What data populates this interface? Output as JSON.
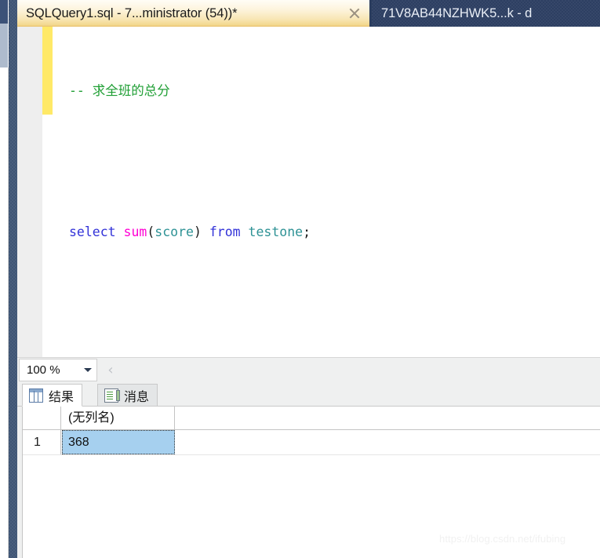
{
  "tabs": [
    {
      "title": "SQLQuery1.sql - 7...ministrator (54))*",
      "active": true,
      "close_icon": "close-icon"
    },
    {
      "title": "71V8AB44NZHWK5...k - d",
      "active": false
    }
  ],
  "editor": {
    "lines": [
      {
        "tokens": [
          {
            "text": "-- 求全班的总分",
            "type": "comment"
          }
        ]
      },
      {
        "tokens": []
      },
      {
        "tokens": [
          {
            "text": "select",
            "type": "keyword"
          },
          {
            "text": " ",
            "type": "plain"
          },
          {
            "text": "sum",
            "type": "func"
          },
          {
            "text": "(",
            "type": "plain"
          },
          {
            "text": "score",
            "type": "ident"
          },
          {
            "text": ")",
            "type": "plain"
          },
          {
            "text": " ",
            "type": "plain"
          },
          {
            "text": "from",
            "type": "keyword"
          },
          {
            "text": " ",
            "type": "plain"
          },
          {
            "text": "testone",
            "type": "ident"
          },
          {
            "text": ";",
            "type": "plain"
          }
        ]
      }
    ]
  },
  "zoom_bar": {
    "value": "100 %",
    "caret_icon": "chevron-down-icon",
    "back_icon": "chevron-left-icon",
    "back_glyph": "‹"
  },
  "results": {
    "tabs": [
      {
        "label": "结果",
        "icon": "results-grid-icon",
        "selected": true
      },
      {
        "label": "消息",
        "icon": "messages-icon",
        "selected": false
      }
    ],
    "grid": {
      "corner_label": "",
      "columns": [
        "(无列名)"
      ],
      "rows": [
        {
          "number": "1",
          "values": [
            "368"
          ]
        }
      ]
    }
  },
  "watermark": "https://blog.csdn.net/ifubing",
  "colors": {
    "active_tab_bg": "#f8e6b4",
    "inactive_tab_bg": "#2d3f62",
    "dock_strip": "#3f5575",
    "change_bar": "#ffe967",
    "selected_cell": "#a6d0ef",
    "comment": "#1e9e33",
    "keyword": "#3232d8",
    "function": "#ff00d4",
    "identifier": "#2e9295"
  }
}
